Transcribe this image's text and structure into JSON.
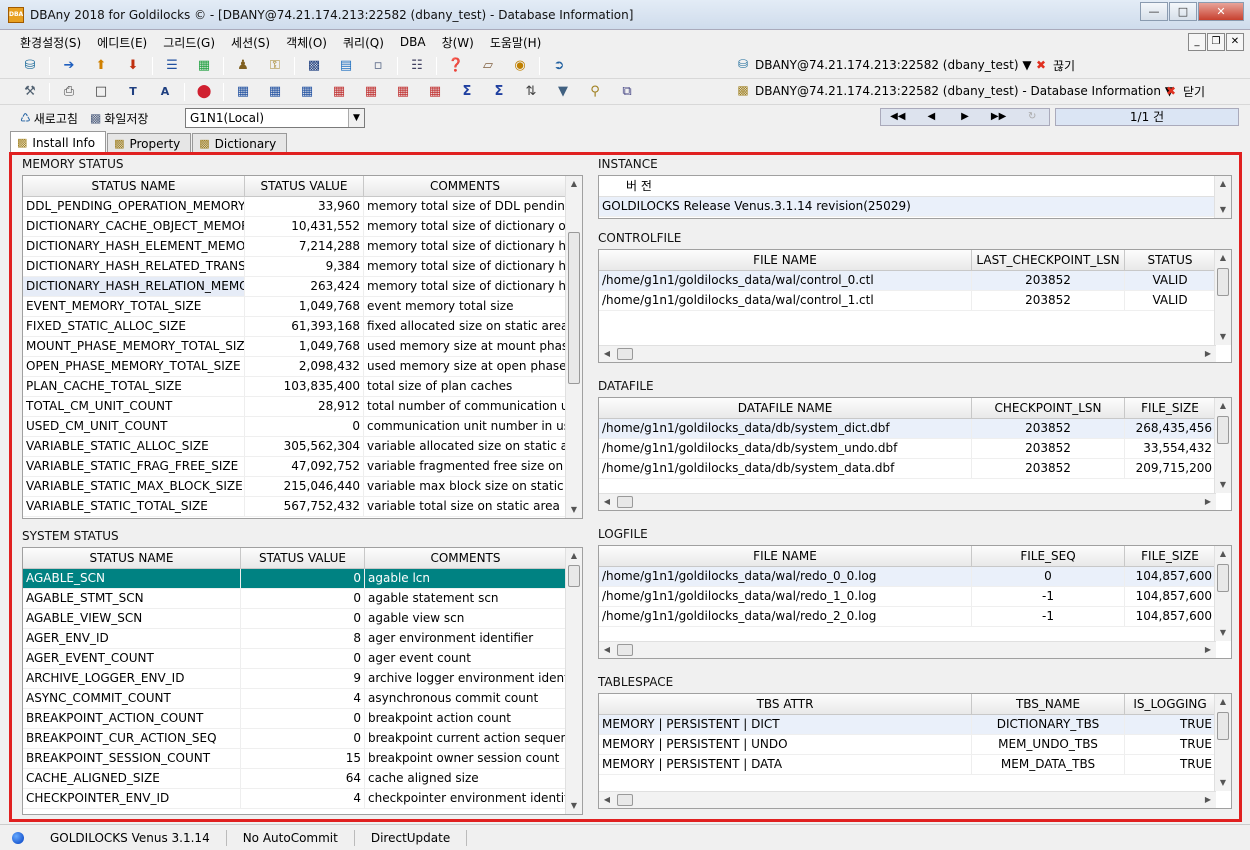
{
  "window": {
    "title": "DBAny 2018 for Goldilocks © - [DBANY@74.21.174.213:22582 (dbany_test) - Database Information]",
    "icon_label": "DBA"
  },
  "menu": [
    "환경설정(S)",
    "에디트(E)",
    "그리드(G)",
    "세션(S)",
    "객체(O)",
    "쿼리(Q)",
    "DBA",
    "창(W)",
    "도움말(H)"
  ],
  "toolbar": {
    "connection1": "DBANY@74.21.174.213:22582 (dbany_test) ▼",
    "disconnect": "끊기",
    "connection2": "DBANY@74.21.174.213:22582 (dbany_test) - Database Information ▼",
    "close": "닫기"
  },
  "row3": {
    "refresh": "새로고침",
    "save_file": "화일저장",
    "node_combo": "G1N1(Local)",
    "page_indicator": "1/1 건"
  },
  "tabs": [
    "Install Info",
    "Property",
    "Dictionary"
  ],
  "memory_status": {
    "title": "MEMORY STATUS",
    "columns": [
      "STATUS NAME",
      "STATUS VALUE",
      "COMMENTS"
    ],
    "rows": [
      [
        "DDL_PENDING_OPERATION_MEMORY_TOTAL_SIZE",
        "33,960",
        "memory total size of DDL pending operation"
      ],
      [
        "DICTIONARY_CACHE_OBJECT_MEMORY_TOTAL_SIZE",
        "10,431,552",
        "memory total size of dictionary object cache"
      ],
      [
        "DICTIONARY_HASH_ELEMENT_MEMORY_TOTAL_SIZE",
        "7,214,288",
        "memory total size of dictionary hash element"
      ],
      [
        "DICTIONARY_HASH_RELATED_TRANS_MEMORY_TOTAL_SIZE",
        "9,384",
        "memory total size of dictionary hash related trans"
      ],
      [
        "DICTIONARY_HASH_RELATION_MEMORY_TOTAL_SIZE",
        "263,424",
        "memory total size of dictionary hash relation"
      ],
      [
        "EVENT_MEMORY_TOTAL_SIZE",
        "1,049,768",
        "event memory total size"
      ],
      [
        "FIXED_STATIC_ALLOC_SIZE",
        "61,393,168",
        "fixed allocated size on static area"
      ],
      [
        "MOUNT_PHASE_MEMORY_TOTAL_SIZE",
        "1,049,768",
        "used memory size at mount phase"
      ],
      [
        "OPEN_PHASE_MEMORY_TOTAL_SIZE",
        "2,098,432",
        "used memory size at open phase"
      ],
      [
        "PLAN_CACHE_TOTAL_SIZE",
        "103,835,400",
        "total size of plan caches"
      ],
      [
        "TOTAL_CM_UNIT_COUNT",
        "28,912",
        "total number of communication units"
      ],
      [
        "USED_CM_UNIT_COUNT",
        "0",
        "communication unit number in use"
      ],
      [
        "VARIABLE_STATIC_ALLOC_SIZE",
        "305,562,304",
        "variable allocated size on static area"
      ],
      [
        "VARIABLE_STATIC_FRAG_FREE_SIZE",
        "47,092,752",
        "variable fragmented free size on static area"
      ],
      [
        "VARIABLE_STATIC_MAX_BLOCK_SIZE",
        "215,046,440",
        "variable max block size on static area"
      ],
      [
        "VARIABLE_STATIC_TOTAL_SIZE",
        "567,752,432",
        "variable total size on static area"
      ]
    ]
  },
  "system_status": {
    "title": "SYSTEM STATUS",
    "columns": [
      "STATUS NAME",
      "STATUS VALUE",
      "COMMENTS"
    ],
    "rows": [
      [
        "AGABLE_SCN",
        "0",
        "agable lcn"
      ],
      [
        "AGABLE_STMT_SCN",
        "0",
        "agable statement scn"
      ],
      [
        "AGABLE_VIEW_SCN",
        "0",
        "agable view scn"
      ],
      [
        "AGER_ENV_ID",
        "8",
        "ager environment identifier"
      ],
      [
        "AGER_EVENT_COUNT",
        "0",
        "ager event count"
      ],
      [
        "ARCHIVE_LOGGER_ENV_ID",
        "9",
        "archive logger environment identifier"
      ],
      [
        "ASYNC_COMMIT_COUNT",
        "4",
        "asynchronous commit count"
      ],
      [
        "BREAKPOINT_ACTION_COUNT",
        "0",
        "breakpoint action count"
      ],
      [
        "BREAKPOINT_CUR_ACTION_SEQ",
        "0",
        "breakpoint current action sequence"
      ],
      [
        "BREAKPOINT_SESSION_COUNT",
        "15",
        "breakpoint owner session count"
      ],
      [
        "CACHE_ALIGNED_SIZE",
        "64",
        "cache aligned size"
      ],
      [
        "CHECKPOINTER_ENV_ID",
        "4",
        "checkpointer environment identifier"
      ]
    ]
  },
  "instance": {
    "title": "INSTANCE",
    "header": "버    전",
    "value": "GOLDILOCKS Release Venus.3.1.14 revision(25029)"
  },
  "controlfile": {
    "title": "CONTROLFILE",
    "columns": [
      "FILE NAME",
      "LAST_CHECKPOINT_LSN",
      "STATUS"
    ],
    "rows": [
      [
        "/home/g1n1/goldilocks_data/wal/control_0.ctl",
        "203852",
        "VALID"
      ],
      [
        "/home/g1n1/goldilocks_data/wal/control_1.ctl",
        "203852",
        "VALID"
      ]
    ]
  },
  "datafile": {
    "title": "DATAFILE",
    "columns": [
      "DATAFILE NAME",
      "CHECKPOINT_LSN",
      "FILE_SIZE"
    ],
    "rows": [
      [
        "/home/g1n1/goldilocks_data/db/system_dict.dbf",
        "203852",
        "268,435,456"
      ],
      [
        "/home/g1n1/goldilocks_data/db/system_undo.dbf",
        "203852",
        "33,554,432"
      ],
      [
        "/home/g1n1/goldilocks_data/db/system_data.dbf",
        "203852",
        "209,715,200"
      ]
    ]
  },
  "logfile": {
    "title": "LOGFILE",
    "columns": [
      "FILE NAME",
      "FILE_SEQ",
      "FILE_SIZE"
    ],
    "rows": [
      [
        "/home/g1n1/goldilocks_data/wal/redo_0_0.log",
        "0",
        "104,857,600"
      ],
      [
        "/home/g1n1/goldilocks_data/wal/redo_1_0.log",
        "-1",
        "104,857,600"
      ],
      [
        "/home/g1n1/goldilocks_data/wal/redo_2_0.log",
        "-1",
        "104,857,600"
      ]
    ]
  },
  "tablespace": {
    "title": "TABLESPACE",
    "columns": [
      "TBS ATTR",
      "TBS_NAME",
      "IS_LOGGING"
    ],
    "rows": [
      [
        "MEMORY | PERSISTENT | DICT",
        "DICTIONARY_TBS",
        "TRUE"
      ],
      [
        "MEMORY | PERSISTENT | UNDO",
        "MEM_UNDO_TBS",
        "TRUE"
      ],
      [
        "MEMORY | PERSISTENT | DATA",
        "MEM_DATA_TBS",
        "TRUE"
      ]
    ]
  },
  "statusbar": {
    "product": "GOLDILOCKS Venus 3.1.14",
    "commit_mode": "No AutoCommit",
    "update_mode": "DirectUpdate"
  },
  "colors": {
    "selection": "#008282",
    "frame_border": "#e02020"
  }
}
